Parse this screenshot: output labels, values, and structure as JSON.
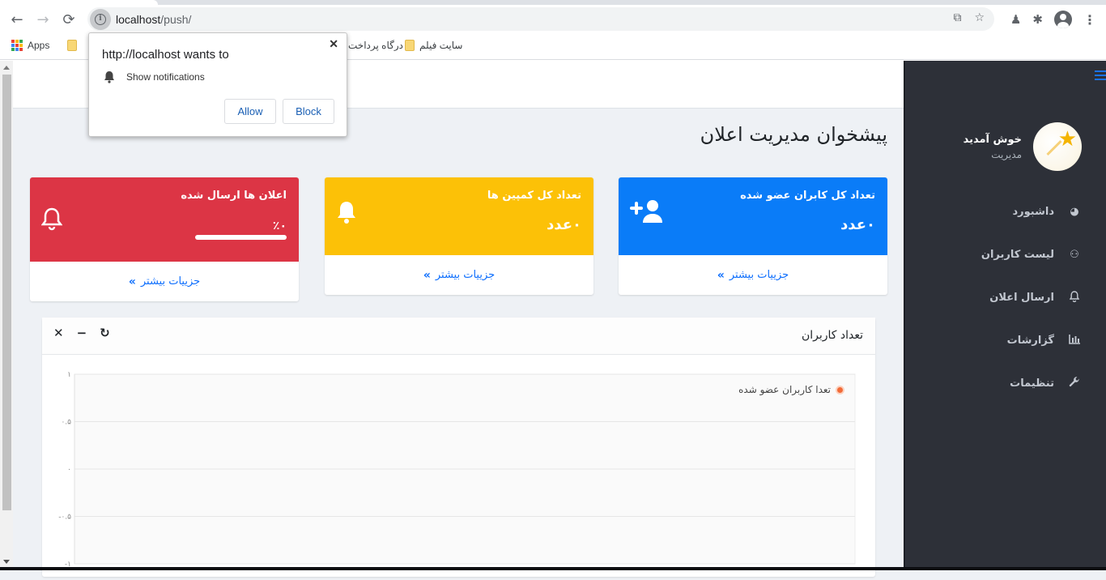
{
  "browser": {
    "url_host": "localhost",
    "url_path": "/push/",
    "bookmarks": [
      {
        "label": "Apps",
        "icon": "apps-grid-icon"
      },
      {
        "label": "",
        "icon": "folder-icon"
      },
      {
        "label": "درگاه پرداخت",
        "icon": "folder-icon"
      },
      {
        "label": "سایت فیلم",
        "icon": "folder-icon"
      }
    ],
    "icons": {
      "back": "←",
      "forward": "→",
      "reload": "⟳",
      "translate": "⧉",
      "star": "☆",
      "extension1": "♟",
      "extension2": "✱",
      "menu": "⋮"
    }
  },
  "permission_popup": {
    "title": "http://localhost wants to",
    "permission": "Show notifications",
    "allow_label": "Allow",
    "block_label": "Block",
    "close": "✕"
  },
  "sidebar": {
    "welcome": "خوش آمدید",
    "role": "مدیریت",
    "items": [
      {
        "label": "داشبورد",
        "icon": "◕"
      },
      {
        "label": "لیست کاربران",
        "icon": "⚇"
      },
      {
        "label": "ارسال اعلان",
        "icon": "🔔"
      },
      {
        "label": "گزارشات",
        "icon": "▥"
      },
      {
        "label": "تنظیمات",
        "icon": "🔧"
      }
    ]
  },
  "page": {
    "title": "پیشخوان مدیریت اعلان"
  },
  "cards": [
    {
      "label": "تعداد کل کابران عضو شده",
      "value": "۰عدد",
      "link": "جزییات بیشتر",
      "chevron": "»",
      "color": "#0a7cf8"
    },
    {
      "label": "تعداد کل کمپین ها",
      "value": "۰عدد",
      "link": "جزییات بیشتر",
      "chevron": "»",
      "color": "#fcc107"
    },
    {
      "label": "اعلان ها ارسال شده",
      "value": "٪۰",
      "progress_percent": 0,
      "link": "جزییات بیشتر",
      "chevron": "»",
      "color": "#dc3545"
    }
  ],
  "chart_card": {
    "title": "تعداد کاربران",
    "tools": {
      "close": "✕",
      "minimize": "−",
      "refresh": "↻"
    }
  },
  "chart_data": {
    "type": "line",
    "title": "",
    "xlabel": "",
    "ylabel": "",
    "series": [
      {
        "name": "تعدا کاربران عضو شده",
        "color": "#f26b38",
        "values": []
      }
    ],
    "y_ticks": [
      "۱",
      "۰.۵",
      "۰",
      "-۰.۵",
      "-۱"
    ],
    "ylim": [
      -1,
      1
    ],
    "grid": true,
    "legend": "top-right"
  }
}
